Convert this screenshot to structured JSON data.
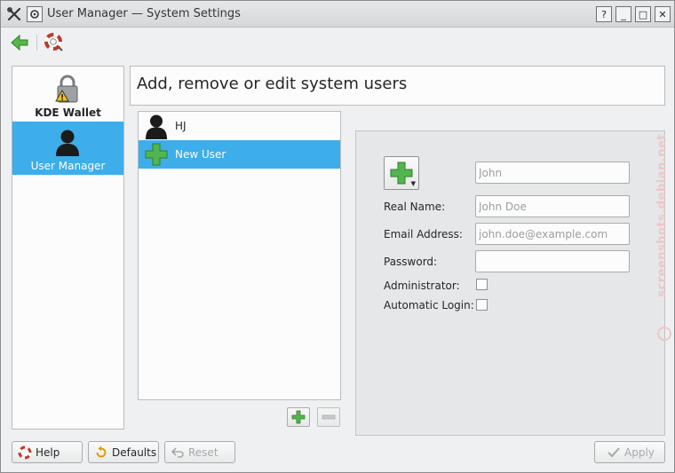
{
  "window": {
    "title": "User Manager  — System Settings",
    "buttons": {
      "help": "?",
      "minimize": "_",
      "maximize": "□",
      "close": "✕"
    }
  },
  "toolbar": {
    "back_icon": "back-arrow-icon",
    "help_icon": "lifebuoy-icon"
  },
  "sidebar": {
    "items": [
      {
        "label": "KDE Wallet",
        "icon": "wallet-lock-icon"
      },
      {
        "label": "User Manager",
        "icon": "user-icon"
      }
    ]
  },
  "header": {
    "title": "Add, remove or edit system users"
  },
  "users": [
    {
      "name": "HJ",
      "icon": "user-icon"
    },
    {
      "name": "New User",
      "icon": "plus-icon"
    }
  ],
  "details": {
    "username_placeholder": "John",
    "realname_label": "Real Name:",
    "realname_placeholder": "John Doe",
    "email_label": "Email Address:",
    "email_placeholder": "john.doe@example.com",
    "password_label": "Password:",
    "admin_label": "Administrator:",
    "autologin_label": "Automatic Login:"
  },
  "buttons": {
    "help": "Help",
    "defaults": "Defaults",
    "reset": "Reset",
    "apply": "Apply"
  },
  "watermark": "screenshots.debian.net",
  "colors": {
    "accent": "#3daee9",
    "plus_green": "#53b550"
  }
}
